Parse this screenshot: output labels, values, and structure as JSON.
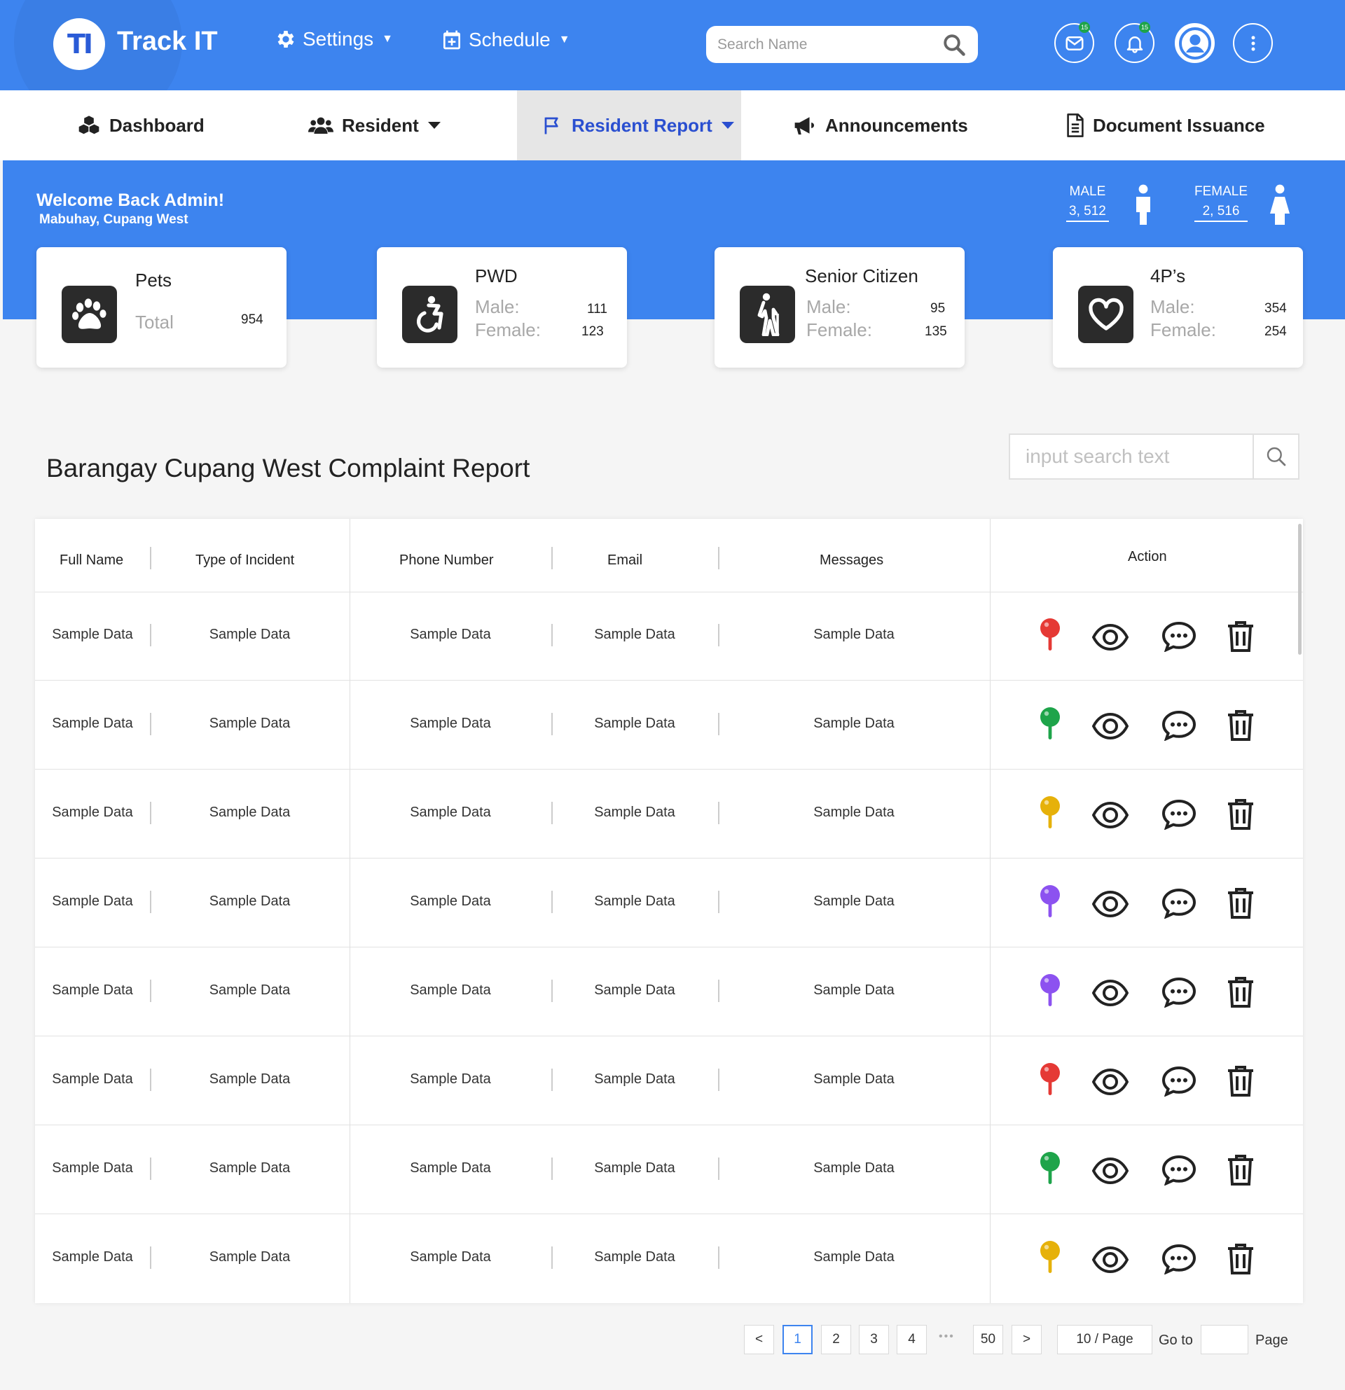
{
  "app": {
    "logo_text": "TI",
    "title": "Track IT"
  },
  "header": {
    "settings_label": "Settings",
    "schedule_label": "Schedule",
    "search_placeholder": "Search Name",
    "mail_badge": "15",
    "notif_badge": "15"
  },
  "tabs": [
    {
      "label": "Dashboard"
    },
    {
      "label": "Resident"
    },
    {
      "label": "Resident Report"
    },
    {
      "label": "Announcements"
    },
    {
      "label": "Document Issuance"
    }
  ],
  "banner": {
    "welcome": "Welcome Back Admin!",
    "location": "Mabuhay, Cupang West",
    "male_label": "MALE",
    "male_value": "3, 512",
    "female_label": "FEMALE",
    "female_value": "2, 516"
  },
  "cards": {
    "pets": {
      "title": "Pets",
      "total_label": "Total",
      "total": "954"
    },
    "pwd": {
      "title": "PWD",
      "male_label": "Male:",
      "male": "111",
      "female_label": "Female:",
      "female": "123"
    },
    "senior": {
      "title": "Senior Citizen",
      "male_label": "Male:",
      "male": "95",
      "female_label": "Female:",
      "female": "135"
    },
    "fourps": {
      "title": "4P’s",
      "male_label": "Male:",
      "male": "354",
      "female_label": "Female:",
      "female": "254"
    }
  },
  "report": {
    "title": "Barangay Cupang West Complaint Report",
    "search_placeholder": "input search text"
  },
  "table": {
    "headers": {
      "full_name": "Full Name",
      "type_of_incident": "Type of  Incident",
      "phone_number": "Phone Number",
      "email": "Email",
      "messages": "Messages",
      "action": "Action"
    },
    "rows": [
      {
        "full_name": "Sample Data",
        "incident": "Sample Data",
        "phone": "Sample Data",
        "email": "Sample Data",
        "message": "Sample Data",
        "pin_color": "#e53935"
      },
      {
        "full_name": "Sample Data",
        "incident": "Sample Data",
        "phone": "Sample Data",
        "email": "Sample Data",
        "message": "Sample Data",
        "pin_color": "#1ea44a"
      },
      {
        "full_name": "Sample Data",
        "incident": "Sample Data",
        "phone": "Sample Data",
        "email": "Sample Data",
        "message": "Sample Data",
        "pin_color": "#e6b10a"
      },
      {
        "full_name": "Sample Data",
        "incident": "Sample Data",
        "phone": "Sample Data",
        "email": "Sample Data",
        "message": "Sample Data",
        "pin_color": "#8c52f0"
      },
      {
        "full_name": "Sample Data",
        "incident": "Sample Data",
        "phone": "Sample Data",
        "email": "Sample Data",
        "message": "Sample Data",
        "pin_color": "#8c52f0"
      },
      {
        "full_name": "Sample Data",
        "incident": "Sample Data",
        "phone": "Sample Data",
        "email": "Sample Data",
        "message": "Sample Data",
        "pin_color": "#e53935"
      },
      {
        "full_name": "Sample Data",
        "incident": "Sample Data",
        "phone": "Sample Data",
        "email": "Sample Data",
        "message": "Sample Data",
        "pin_color": "#1ea44a"
      },
      {
        "full_name": "Sample Data",
        "incident": "Sample Data",
        "phone": "Sample Data",
        "email": "Sample Data",
        "message": "Sample Data",
        "pin_color": "#e6b10a"
      }
    ]
  },
  "pagination": {
    "prev": "<",
    "pages": [
      "1",
      "2",
      "3",
      "4"
    ],
    "ellipsis": "•••",
    "last": "50",
    "next": ">",
    "page_size": "10 / Page",
    "goto_label": "Go to",
    "page_label": "Page",
    "current": "1"
  },
  "colors": {
    "primary": "#3d84ef",
    "active_tab_text": "#2a4fd0"
  }
}
